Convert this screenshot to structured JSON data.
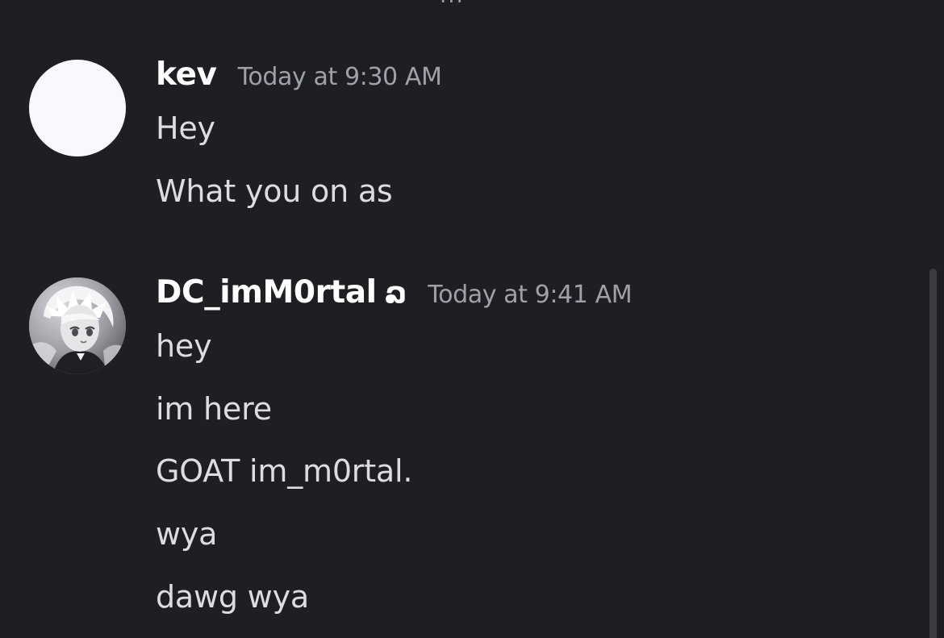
{
  "top_fragment": "...",
  "messages": [
    {
      "username": "kev",
      "timestamp": "Today at 9:30 AM",
      "lines": [
        "Hey",
        "What you on as"
      ]
    },
    {
      "username": "DC_imM0rtal",
      "badge": "ລ",
      "timestamp": "Today at 9:41 AM",
      "lines": [
        "hey",
        "im here",
        "GOAT im_m0rtal.",
        "wya",
        "dawg wya"
      ]
    }
  ],
  "icons": {
    "kev_avatar": "avatar-placeholder-white",
    "dc_avatar": "anime-avatar-grayscale"
  },
  "colors": {
    "background": "#1e1f23",
    "username": "#ffffff",
    "timestamp": "#9ea0aa",
    "message_text": "#dbdde2"
  }
}
